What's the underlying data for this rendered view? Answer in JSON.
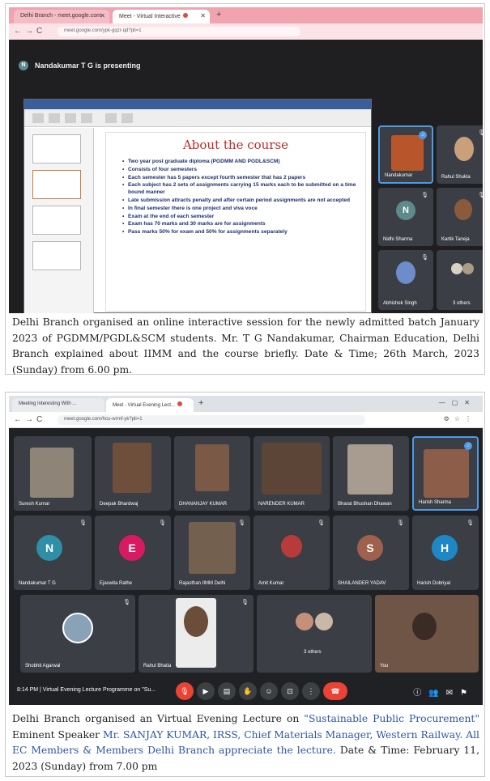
{
  "panel1": {
    "browser": {
      "tab1_title": "Delhi Branch - meet.google.com",
      "tab2_title": "Meet - Virtual Interactive",
      "url": "meet.google.com/ypk-gqzr-qd?pli=1"
    },
    "presenter": {
      "avatar_letter": "N",
      "text": "Nandakumar T G is presenting"
    },
    "slide": {
      "title": "About the course",
      "bullets": [
        "Two year post graduate diploma (PGDMM AND PGDL&SCM)",
        "Consists of four semesters",
        "Each semester has 5 papers except fourth semester that has 2 papers",
        "Each subject has 2 sets of assignments carrying 15 marks each to be submitted on a time bound manner",
        "Late submission attracts penalty and after certain period assignments are not accepted",
        "In final semester there is one project and viva voce",
        "Exam at the end of each semester",
        "Exam has 70 marks and 30 marks are for assignments",
        "Pass marks 50% for exam and 50% for assignments separately"
      ]
    },
    "participants": [
      {
        "name": "Nandakumar"
      },
      {
        "name": "Rahul Shukla"
      },
      {
        "name": "Nidhi Sharma",
        "initial": "N"
      },
      {
        "name": "Kartik Taneja"
      },
      {
        "name": "Abhishek Singh"
      },
      {
        "name": "3 others"
      }
    ],
    "caption": "Delhi Branch organised an online interactive session for the newly admitted batch January 2023 of PGDMM/PGDL&SCM students. Mr. T G Nandakumar, Chairman Education, Delhi Branch explained about IIMM and the course briefly. Date & Time; 26th March, 2023 (Sunday) from 6.00 pm."
  },
  "panel2": {
    "browser": {
      "tab1_title": "Meeting Interesting With ...",
      "tab2_title": "Meet - Virtual Evening Lect...",
      "url": "meet.google.com/hcu-wrmf-yk?pli=1"
    },
    "participants": [
      {
        "name": "Suresh Kumar"
      },
      {
        "name": "Deepak Bhardwaj"
      },
      {
        "name": "DHANANJAY KUMAR"
      },
      {
        "name": "NARENDER KUMAR"
      },
      {
        "name": "Bharat Bhushan Dhawan"
      },
      {
        "name": "Harish Sharma"
      },
      {
        "name": "Nandakumar T G",
        "initial": "N",
        "color": "#2e8fa6"
      },
      {
        "name": "Ejaswita Rathe",
        "initial": "E",
        "color": "#d81b60"
      },
      {
        "name": "Rajasthan IIMM Delhi"
      },
      {
        "name": "Amit Kumar"
      },
      {
        "name": "SHAILANDER YADAV",
        "initial": "S",
        "color": "#a0604e"
      },
      {
        "name": "Harish Dobriyal",
        "initial": "H",
        "color": "#1e88c7"
      },
      {
        "name": "Shobhit Agarwal"
      },
      {
        "name": "Rahul Bhatia"
      },
      {
        "name": "3 others"
      },
      {
        "name": "You"
      }
    ],
    "meeting_bar": {
      "time_text": "8:14 PM | Virtual Evening Lecture Programme on \"Su..."
    },
    "caption": {
      "part1": "Delhi Branch organised an Virtual Evening Lecture on ",
      "topic": "\"Sustainable Public Procurement\"",
      "part2": " Eminent Speaker ",
      "speaker": "Mr. SANJAY KUMAR, IRSS, Chief Materials Manager, Western Railway.  All EC Members & Members Delhi Branch appreciate the lecture.",
      "part3": " Date & Time:  February 11, 2023 (Sunday) from 7.00 pm"
    }
  },
  "colors": {
    "slide_title": "#c62828",
    "highlight_text": "#2a56a8",
    "meet_background": "#202124"
  }
}
